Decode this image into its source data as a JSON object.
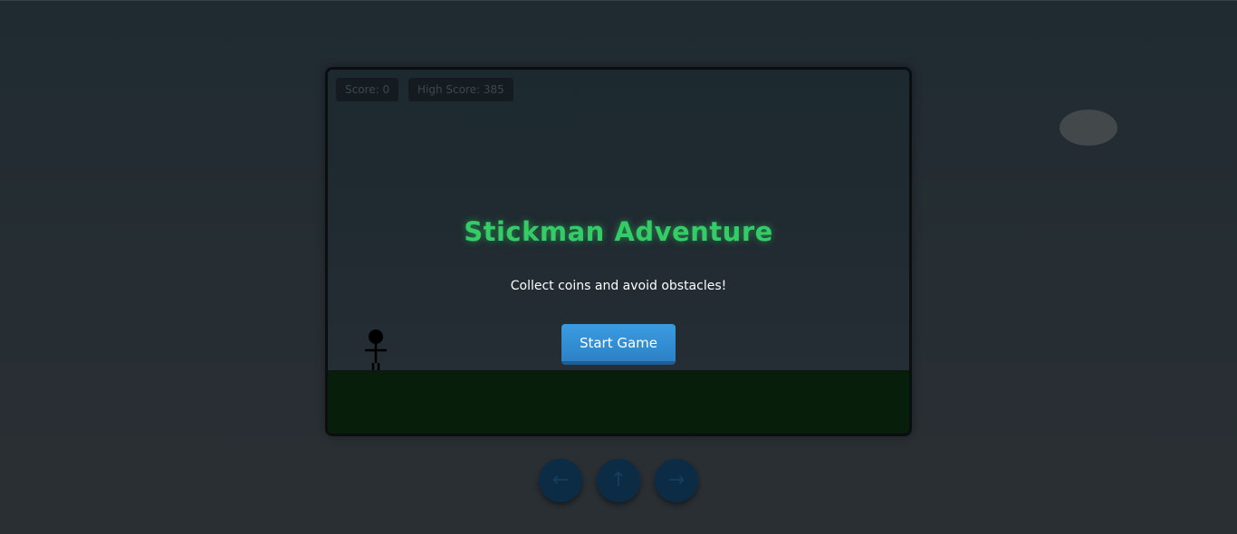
{
  "hud": {
    "score_label": "Score: 0",
    "high_score_label": "High Score: 385"
  },
  "menu": {
    "title": "Stickman Adventure",
    "subtitle": "Collect coins and avoid obstacles!",
    "start_button_label": "Start Game"
  },
  "controls": {
    "left_label": "←",
    "up_label": "↑",
    "right_label": "→"
  },
  "icons": {
    "player": "stickman-icon",
    "moon": "moon-icon"
  },
  "colors": {
    "title": "#33cc66",
    "start_button": "#3b9be0",
    "ground": "#071e0b",
    "control_button": "#0c2c46"
  }
}
